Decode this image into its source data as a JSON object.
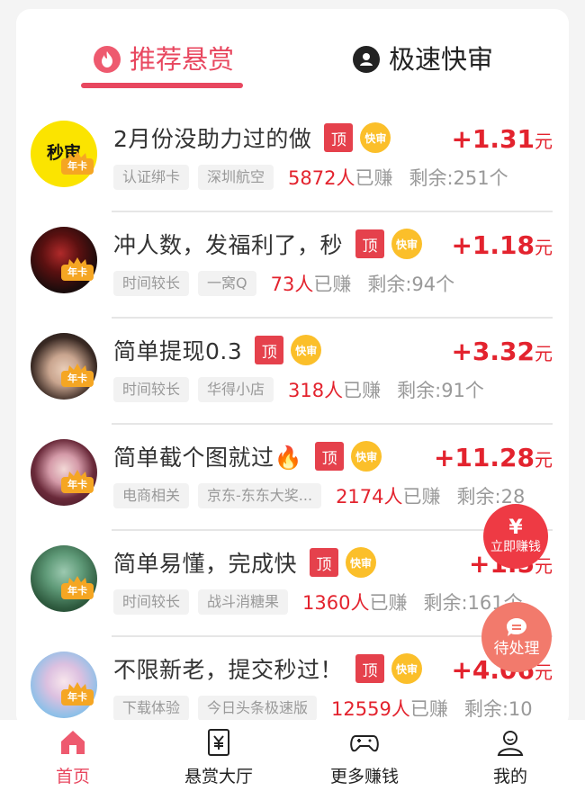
{
  "tabs": {
    "recommended": "推荐悬赏",
    "fast_review": "极速快审"
  },
  "labels": {
    "top": "顶",
    "fast": "快审",
    "earned_suffix": "已赚",
    "badge": "年卡",
    "currency": "元",
    "avatar_text_0": "秒审"
  },
  "tasks": [
    {
      "title": "2月份没助力过的做",
      "price": "+1.31",
      "tag1": "认证绑卡",
      "tag2": "深圳航空",
      "earned": "5872人",
      "remaining": "剩余:251个"
    },
    {
      "title": "冲人数，发福利了，秒",
      "price": "+1.18",
      "tag1": "时间较长",
      "tag2": "一窝Q",
      "earned": "73人",
      "remaining": "剩余:94个"
    },
    {
      "title": "简单提现0.3",
      "price": "+3.32",
      "tag1": "时间较长",
      "tag2": "华得小店",
      "earned": "318人",
      "remaining": "剩余:91个"
    },
    {
      "title": "简单截个图就过🔥",
      "price": "+11.28",
      "tag1": "电商相关",
      "tag2": "京东-东东大奖...",
      "earned": "2174人",
      "remaining": "剩余:28"
    },
    {
      "title": "简单易懂，完成快",
      "price": "+1.5",
      "tag1": "时间较长",
      "tag2": "战斗消糖果",
      "earned": "1360人",
      "remaining": "剩余:161个"
    },
    {
      "title": "不限新老，提交秒过！",
      "price": "+4.06",
      "tag1": "下载体验",
      "tag2": "今日头条极速版",
      "earned": "12559人",
      "remaining": "剩余:10"
    }
  ],
  "floating": {
    "earn_now": "立即赚钱",
    "earn_now_symbol": "¥",
    "pending": "待处理"
  },
  "nav": {
    "home": "首页",
    "hall": "悬赏大厅",
    "more": "更多赚钱",
    "mine": "我的"
  },
  "colors": {
    "accent": "#e8475f",
    "price": "#e3232e",
    "top_tag": "#e5414c",
    "fast_tag": "#fbbf2a"
  },
  "icons": {
    "tab_recommended": "fire-icon",
    "tab_fast": "user-circle-icon",
    "nav_home": "home-icon",
    "nav_hall": "yen-document-icon",
    "nav_more": "gamepad-icon",
    "nav_mine": "person-icon"
  }
}
